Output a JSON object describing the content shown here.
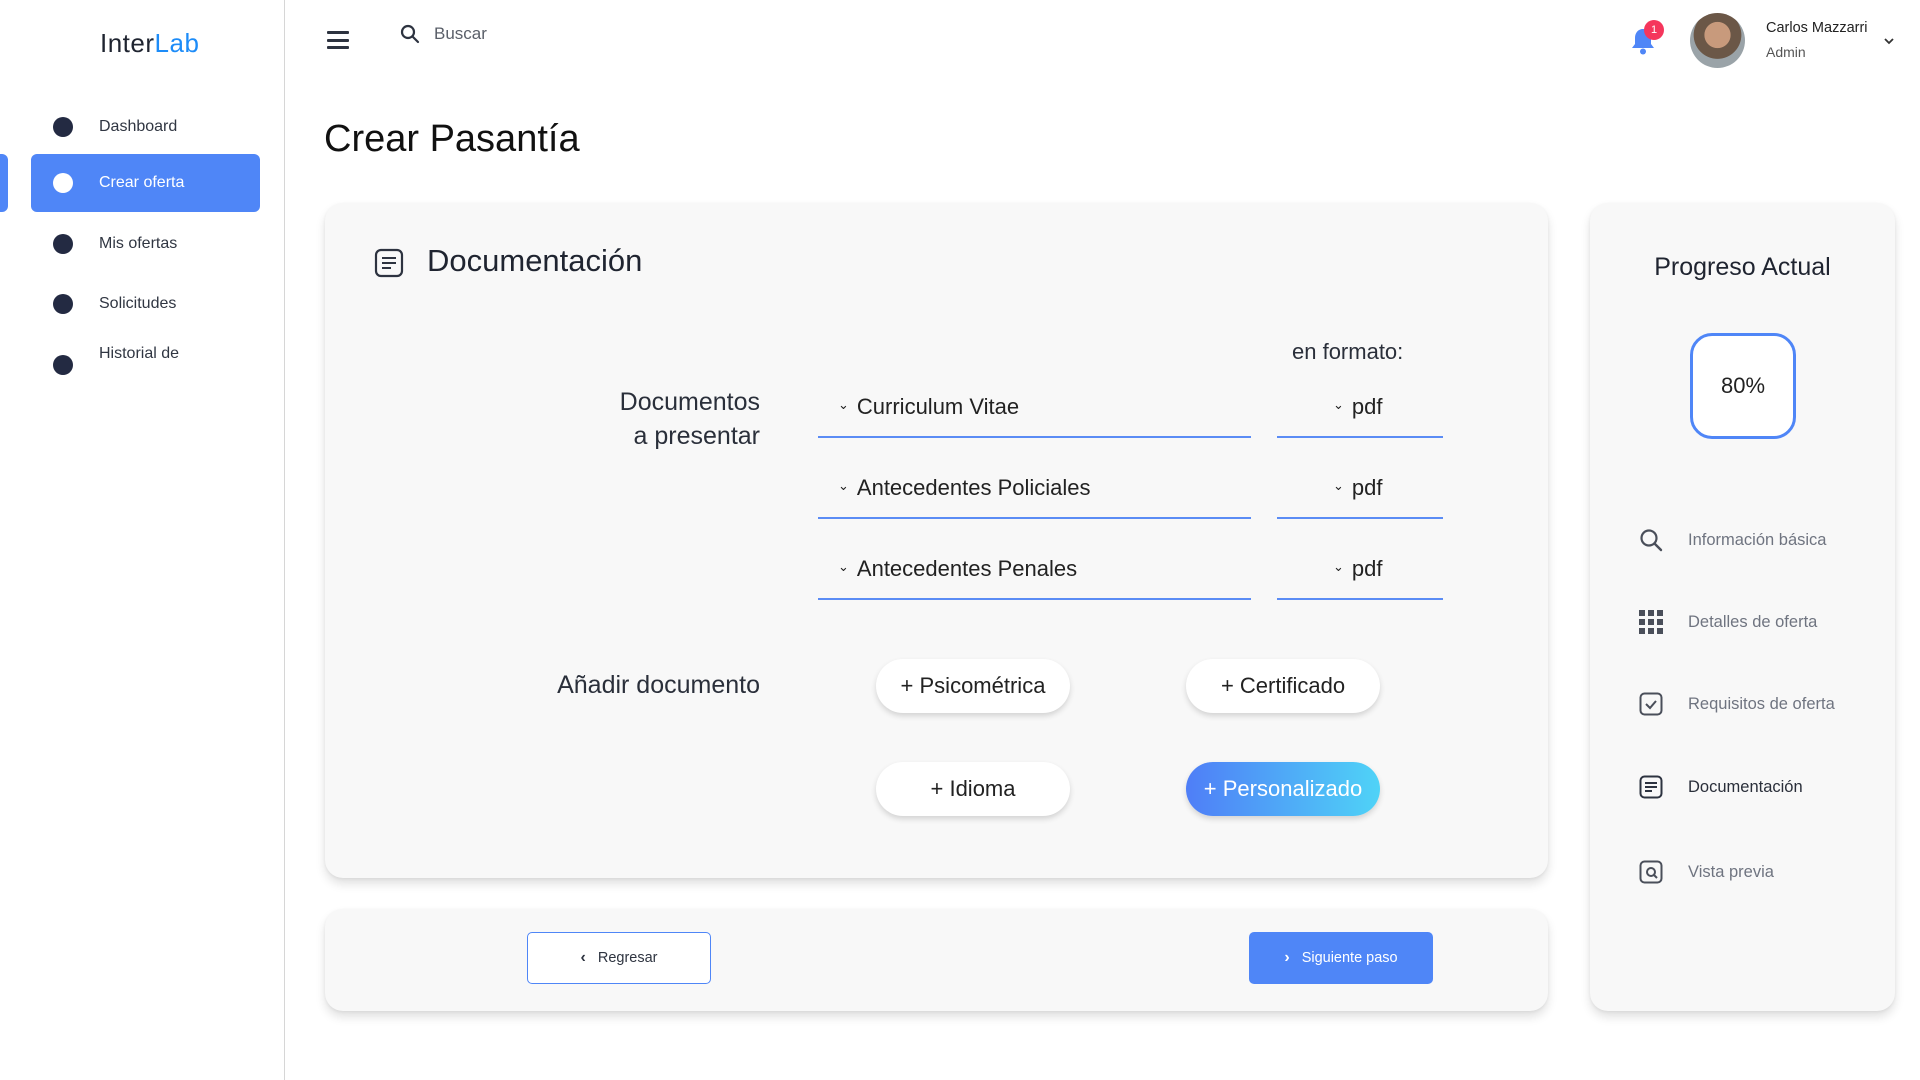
{
  "app": {
    "logo_inter": "Inter",
    "logo_lab": "Lab"
  },
  "sidebar": {
    "items": [
      {
        "label": "Dashboard",
        "active": false
      },
      {
        "label": "Crear oferta",
        "active": true
      },
      {
        "label": "Mis ofertas",
        "active": false
      },
      {
        "label": "Solicitudes",
        "active": false
      },
      {
        "label": "Historial de",
        "active": false
      }
    ]
  },
  "topbar": {
    "search_placeholder": "Buscar",
    "notification_count": "1",
    "user_name": "Carlos Mazzarri",
    "user_role": "Admin"
  },
  "page": {
    "title": "Crear Pasantía"
  },
  "documentation": {
    "title": "Documentación",
    "docs_label_line1": "Documentos",
    "docs_label_line2": "a presentar",
    "format_header": "en formato:",
    "rows": [
      {
        "document": "Curriculum Vitae",
        "format": "pdf"
      },
      {
        "document": "Antecedentes Policiales",
        "format": "pdf"
      },
      {
        "document": "Antecedentes Penales",
        "format": "pdf"
      }
    ],
    "add_label": "Añadir documento",
    "add_buttons": [
      {
        "label": "+ Psicométrica"
      },
      {
        "label": "+ Certificado"
      },
      {
        "label": "+ Idioma"
      },
      {
        "label": "+ Personalizado"
      }
    ]
  },
  "navigation": {
    "back_label": "Regresar",
    "next_label": "Siguiente paso"
  },
  "progress": {
    "title": "Progreso Actual",
    "percent_label": "80%",
    "percent_value": 80,
    "steps": [
      {
        "label": "Información básica",
        "icon": "search-icon"
      },
      {
        "label": "Detalles de oferta",
        "icon": "grid-icon"
      },
      {
        "label": "Requisitos de oferta",
        "icon": "checkbox-icon"
      },
      {
        "label": "Documentación",
        "icon": "document-icon",
        "current": true
      },
      {
        "label": "Vista previa",
        "icon": "preview-icon"
      }
    ]
  },
  "colors": {
    "accent": "#4f86f7",
    "badge": "#f5365c",
    "gradient_end": "#4fd3f7"
  }
}
